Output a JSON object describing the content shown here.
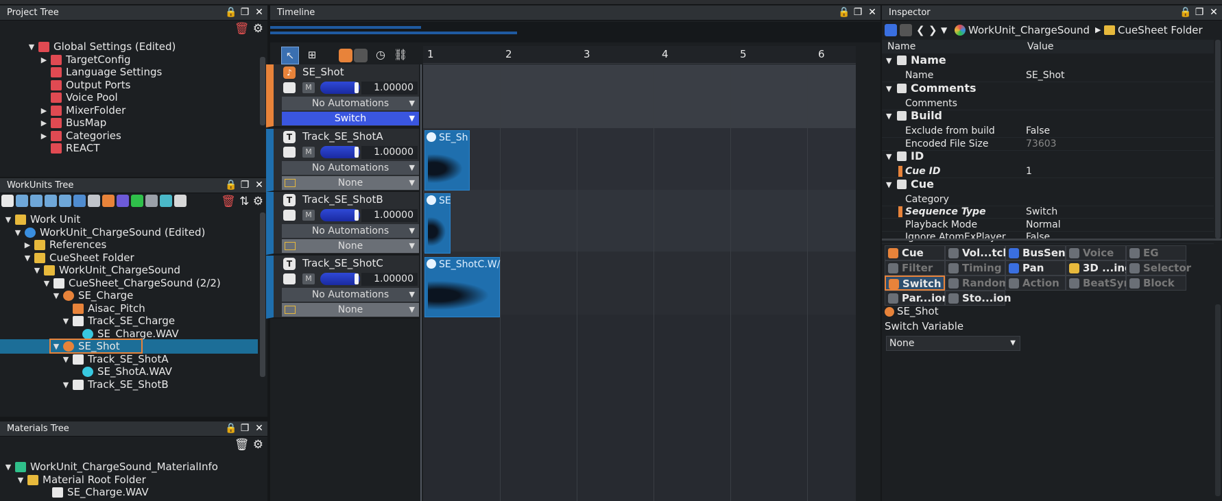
{
  "top_strip": {
    "text": ""
  },
  "project_tree": {
    "title": "Project Tree",
    "items": [
      {
        "label": "Global Settings (Edited)",
        "level": 1,
        "toggle": "▼"
      },
      {
        "label": "TargetConfig",
        "level": 2,
        "toggle": "▶"
      },
      {
        "label": "Language Settings",
        "level": 2,
        "toggle": ""
      },
      {
        "label": "Output Ports",
        "level": 2,
        "toggle": ""
      },
      {
        "label": "Voice Pool",
        "level": 2,
        "toggle": ""
      },
      {
        "label": "MixerFolder",
        "level": 2,
        "toggle": "▶"
      },
      {
        "label": "BusMap",
        "level": 2,
        "toggle": "▶"
      },
      {
        "label": "Categories",
        "level": 2,
        "toggle": "▶"
      },
      {
        "label": "REACT",
        "level": 2,
        "toggle": ""
      }
    ]
  },
  "workunits_tree": {
    "title": "WorkUnits Tree",
    "items": [
      {
        "label": "Work Unit",
        "level": 0,
        "toggle": "▼"
      },
      {
        "label": "WorkUnit_ChargeSound (Edited)",
        "level": 1,
        "toggle": "▼"
      },
      {
        "label": "References",
        "level": 2,
        "toggle": "▶"
      },
      {
        "label": "CueSheet Folder",
        "level": 2,
        "toggle": "▼"
      },
      {
        "label": "WorkUnit_ChargeSound",
        "level": 3,
        "toggle": "▼"
      },
      {
        "label": "CueSheet_ChargeSound (2/2)",
        "level": 4,
        "toggle": "▼"
      },
      {
        "label": "SE_Charge",
        "level": 5,
        "toggle": "▼"
      },
      {
        "label": "Aisac_Pitch",
        "level": 6,
        "toggle": ""
      },
      {
        "label": "Track_SE_Charge",
        "level": 6,
        "toggle": "▼"
      },
      {
        "label": "SE_Charge.WAV",
        "level": 7,
        "toggle": ""
      },
      {
        "label": "SE_Shot",
        "level": 5,
        "toggle": "▼"
      },
      {
        "label": "Track_SE_ShotA",
        "level": 6,
        "toggle": "▼"
      },
      {
        "label": "SE_ShotA.WAV",
        "level": 7,
        "toggle": ""
      },
      {
        "label": "Track_SE_ShotB",
        "level": 6,
        "toggle": "▼"
      }
    ]
  },
  "materials_tree": {
    "title": "Materials Tree",
    "items": [
      {
        "label": "WorkUnit_ChargeSound_MaterialInfo",
        "level": 0,
        "toggle": "▼"
      },
      {
        "label": "Material Root Folder",
        "level": 1,
        "toggle": "▼"
      },
      {
        "label": "SE_Charge.WAV",
        "level": 3,
        "toggle": ""
      }
    ]
  },
  "timeline": {
    "title": "Timeline",
    "ruler": [
      "1",
      "2",
      "3",
      "4",
      "5",
      "6"
    ],
    "cue": {
      "name": "SE_Shot",
      "mute": "M",
      "volume": "1.00000",
      "automation": "No Automations",
      "mode": "Switch"
    },
    "tracks": [
      {
        "name": "Track_SE_ShotA",
        "mute": "M",
        "volume": "1.00000",
        "automation": "No Automations",
        "selector": "None",
        "clip": "SE_Sh"
      },
      {
        "name": "Track_SE_ShotB",
        "mute": "M",
        "volume": "1.00000",
        "automation": "No Automations",
        "selector": "None",
        "clip": "SE"
      },
      {
        "name": "Track_SE_ShotC",
        "mute": "M",
        "volume": "1.00000",
        "automation": "No Automations",
        "selector": "None",
        "clip": "SE_ShotC.W/"
      }
    ]
  },
  "inspector": {
    "title": "Inspector",
    "breadcrumb": [
      "WorkUnit_ChargeSound",
      "CueSheet Folder"
    ],
    "col_name": "Name",
    "col_value": "Value",
    "sections": {
      "name": {
        "header": "Name",
        "name_label": "Name",
        "name_value": "SE_Shot"
      },
      "comments": {
        "header": "Comments",
        "label": "Comments"
      },
      "build": {
        "header": "Build",
        "exclude_label": "Exclude from build",
        "exclude_value": "False",
        "size_label": "Encoded File Size",
        "size_value": "73603"
      },
      "id": {
        "header": "ID",
        "cue_id_label": "Cue ID",
        "cue_id_value": "1"
      },
      "cue": {
        "header": "Cue",
        "category_label": "Category",
        "seq_label": "Sequence Type",
        "seq_value": "Switch",
        "playback_label": "Playback Mode",
        "playback_value": "Normal",
        "ignore_label": "Ignore AtomExPlayer",
        "ignore_value": "False"
      }
    },
    "tabs": [
      [
        "Cue",
        "Vol...tch",
        "BusSend",
        "Voice",
        "EG"
      ],
      [
        "Filter",
        "Timing",
        "Pan",
        "3D ...ing",
        "Selector"
      ],
      [
        "Switch",
        "Random",
        "Action",
        "BeatSync",
        "Block"
      ],
      [
        "Par...ion",
        "Sto...ion"
      ]
    ],
    "switch_panel": {
      "cue_name": "SE_Shot",
      "variable_label": "Switch Variable",
      "variable_value": "None"
    }
  },
  "colors": {
    "accent_orange": "#e8833a",
    "selection_blue": "#1f6fae",
    "switch_blue": "#3a56e0"
  }
}
